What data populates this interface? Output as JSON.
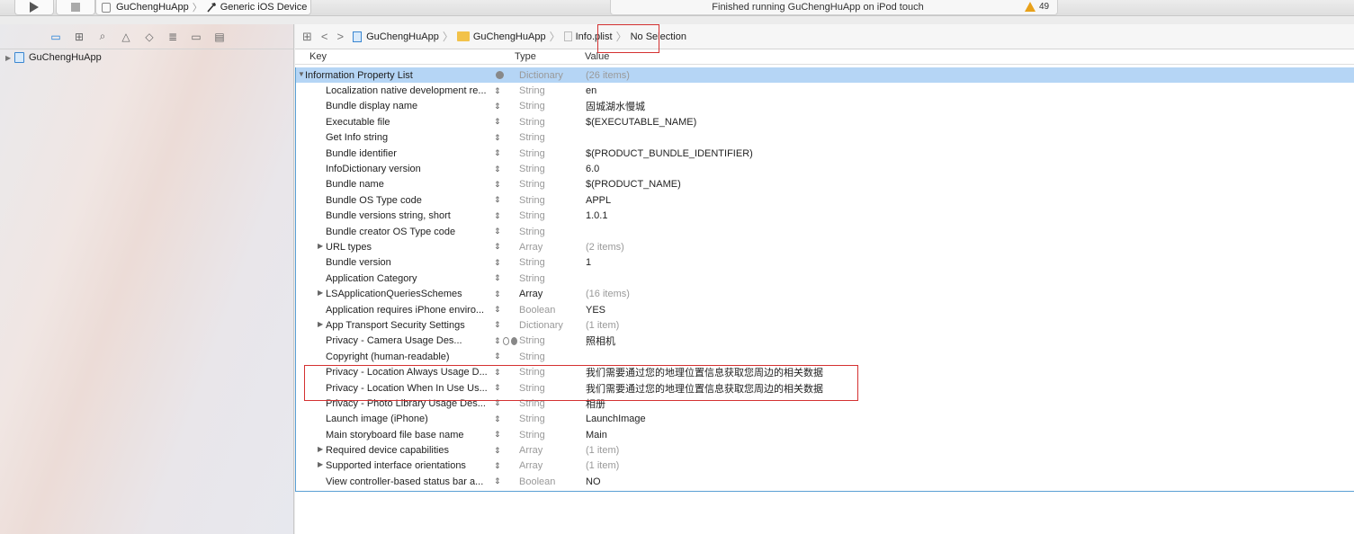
{
  "toolbar": {
    "scheme_target": "GuChengHuApp",
    "device": "Generic iOS Device",
    "status": "Finished running GuChengHuApp on iPod touch",
    "warnings": "49"
  },
  "navigator": {
    "project": "GuChengHuApp"
  },
  "jumpbar": {
    "crumbs": [
      "GuChengHuApp",
      "GuChengHuApp",
      "Info.plist",
      "No Selection"
    ]
  },
  "plist": {
    "headers": {
      "key": "Key",
      "type": "Type",
      "value": "Value"
    },
    "rows": [
      {
        "key": "Information Property List",
        "type": "Dictionary",
        "value": "(26 items)"
      },
      {
        "key": "Localization native development re...",
        "type": "String",
        "value": "en"
      },
      {
        "key": "Bundle display name",
        "type": "String",
        "value": "固城湖水慢城"
      },
      {
        "key": "Executable file",
        "type": "String",
        "value": "$(EXECUTABLE_NAME)"
      },
      {
        "key": "Get Info string",
        "type": "String",
        "value": ""
      },
      {
        "key": "Bundle identifier",
        "type": "String",
        "value": "$(PRODUCT_BUNDLE_IDENTIFIER)"
      },
      {
        "key": "InfoDictionary version",
        "type": "String",
        "value": "6.0"
      },
      {
        "key": "Bundle name",
        "type": "String",
        "value": "$(PRODUCT_NAME)"
      },
      {
        "key": "Bundle OS Type code",
        "type": "String",
        "value": "APPL"
      },
      {
        "key": "Bundle versions string, short",
        "type": "String",
        "value": "1.0.1"
      },
      {
        "key": "Bundle creator OS Type code",
        "type": "String",
        "value": ""
      },
      {
        "key": "URL types",
        "type": "Array",
        "value": "(2 items)"
      },
      {
        "key": "Bundle version",
        "type": "String",
        "value": "1"
      },
      {
        "key": "Application Category",
        "type": "String",
        "value": ""
      },
      {
        "key": "LSApplicationQueriesSchemes",
        "type": "Array",
        "value": "(16 items)"
      },
      {
        "key": "Application requires iPhone enviro...",
        "type": "Boolean",
        "value": "YES"
      },
      {
        "key": "App Transport Security Settings",
        "type": "Dictionary",
        "value": "(1 item)"
      },
      {
        "key": "Privacy - Camera Usage Des...",
        "type": "String",
        "value": "照相机"
      },
      {
        "key": "Copyright (human-readable)",
        "type": "String",
        "value": ""
      },
      {
        "key": "Privacy - Location Always Usage D...",
        "type": "String",
        "value": "我们需要通过您的地理位置信息获取您周边的相关数据"
      },
      {
        "key": "Privacy - Location When In Use Us...",
        "type": "String",
        "value": "我们需要通过您的地理位置信息获取您周边的相关数据"
      },
      {
        "key": "Privacy - Photo Library Usage Des...",
        "type": "String",
        "value": "相册"
      },
      {
        "key": "Launch image (iPhone)",
        "type": "String",
        "value": "LaunchImage"
      },
      {
        "key": "Main storyboard file base name",
        "type": "String",
        "value": "Main"
      },
      {
        "key": "Required device capabilities",
        "type": "Array",
        "value": "(1 item)"
      },
      {
        "key": "Supported interface orientations",
        "type": "Array",
        "value": "(1 item)"
      },
      {
        "key": "View controller-based status bar a...",
        "type": "Boolean",
        "value": "NO"
      }
    ]
  }
}
